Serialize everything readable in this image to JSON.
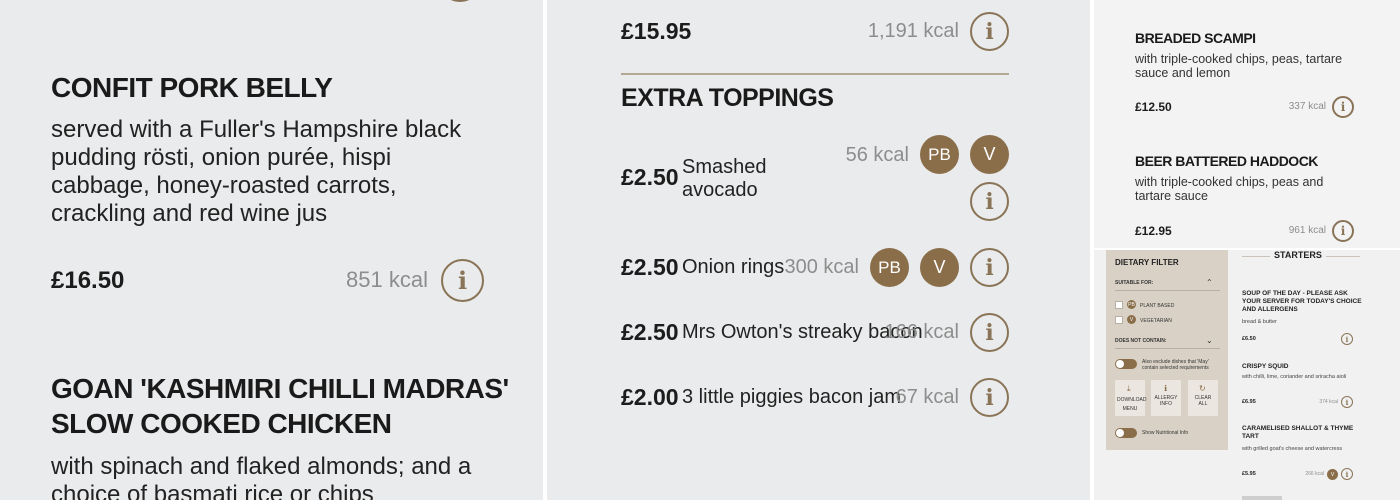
{
  "panel1": {
    "items": [
      {
        "title": "CONFIT PORK BELLY",
        "description": "served with a Fuller's Hampshire black pudding rösti, onion purée, hispi cabbage, honey-roasted carrots, crackling and red wine jus",
        "price": "£16.50",
        "kcal": "851 kcal"
      },
      {
        "title_line1": "GOAN 'KASHMIRI CHILLI MADRAS'",
        "title_line2": "SLOW COOKED CHICKEN",
        "description": "with spinach and flaked almonds; and a choice of basmati rice or chips"
      }
    ]
  },
  "panel2": {
    "top_price": "£15.95",
    "top_kcal": "1,191 kcal",
    "section_title": "EXTRA TOPPINGS",
    "toppings": [
      {
        "price": "£2.50",
        "name_line1": "Smashed",
        "name_line2": "avocado",
        "kcal": "56 kcal",
        "badges": [
          "PB",
          "V"
        ]
      },
      {
        "price": "£2.50",
        "name": "Onion rings",
        "kcal": "300 kcal",
        "badges": [
          "PB",
          "V"
        ]
      },
      {
        "price": "£2.50",
        "name": "Mrs Owton's streaky bacon",
        "kcal": "166 kcal"
      },
      {
        "price": "£2.00",
        "name": "3 little piggies bacon jam",
        "kcal": "67 kcal"
      }
    ]
  },
  "panel3": {
    "items": [
      {
        "title": "BREADED SCAMPI",
        "description": "with triple-cooked chips, peas, tartare sauce and lemon",
        "price": "£12.50",
        "kcal": "337 kcal"
      },
      {
        "title": "BEER BATTERED HADDOCK",
        "description": "with triple-cooked chips, peas and tartare sauce",
        "price": "£12.95",
        "kcal": "961 kcal"
      }
    ]
  },
  "panel4": {
    "filter": {
      "title": "DIETARY FILTER",
      "suitable_for": "SUITABLE FOR:",
      "options": [
        {
          "badge": "PB",
          "label": "PLANT BASED"
        },
        {
          "badge": "V",
          "label": "VEGETARIAN"
        }
      ],
      "does_not_contain": "DOES NOT CONTAIN:",
      "exclude_toggle": "Also exclude dishes that 'May' contain selected requirements",
      "tools": [
        {
          "label_line1": "DOWNLOAD",
          "label_line2": "MENU"
        },
        {
          "label_line1": "ALLERGY",
          "label_line2": "INFO"
        },
        {
          "label_line1": "CLEAR",
          "label_line2": "ALL"
        }
      ],
      "nutrition_toggle": "Show Nutritional Info"
    },
    "section_title": "STARTERS",
    "items": [
      {
        "title": "SOUP OF THE DAY - PLEASE ASK YOUR SERVER FOR TODAY'S CHOICE AND ALLERGENS",
        "description": "bread & butter",
        "price": "£6.50"
      },
      {
        "title": "CRISPY SQUID",
        "description": "with chilli, lime, coriander and sriracha aioli",
        "price": "£6.95",
        "kcal": "374 kcal"
      },
      {
        "title": "CARAMELISED SHALLOT & THYME TART",
        "description": "with grilled goat's cheese and watercress",
        "price": "£5.95",
        "kcal": "266 kcal",
        "badge": "V"
      }
    ]
  },
  "icons": {
    "info": "i"
  },
  "colors": {
    "accent": "#8a6e4a",
    "kcal": "#8d8d8d",
    "background": "#eaebec"
  }
}
